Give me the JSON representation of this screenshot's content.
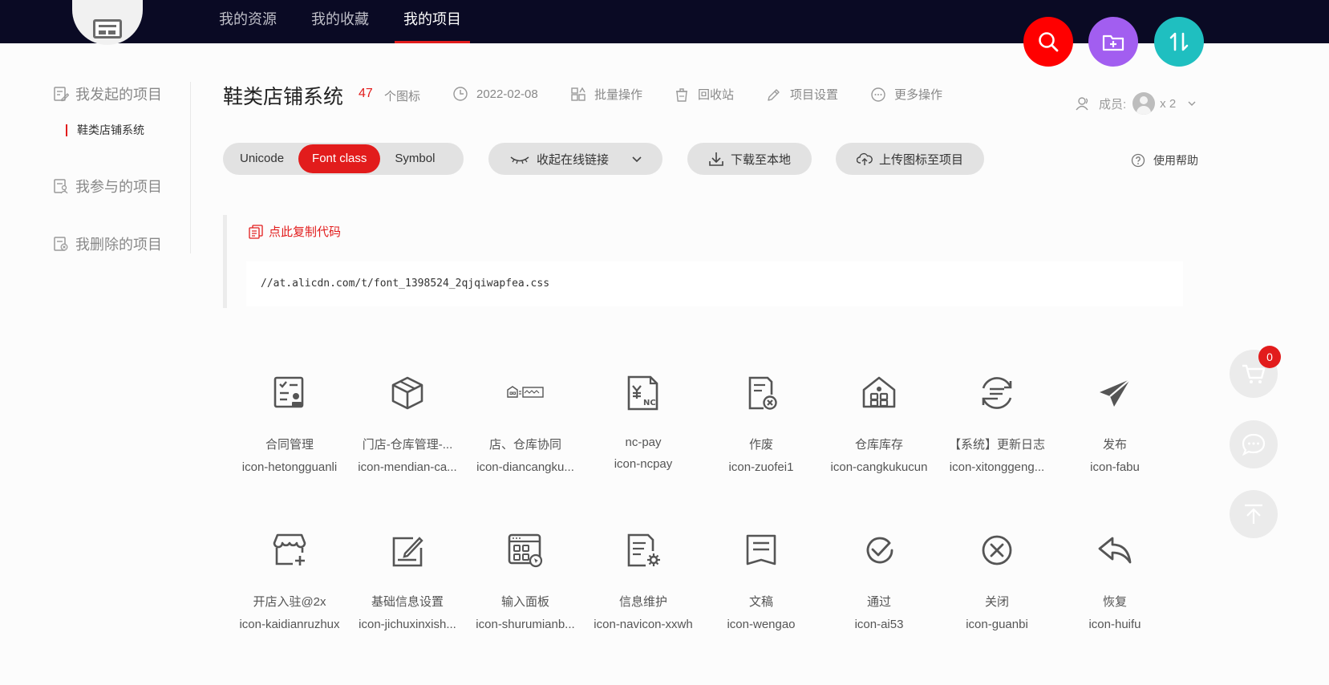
{
  "nav": {
    "tabs": [
      {
        "label": "我的资源"
      },
      {
        "label": "我的收藏"
      },
      {
        "label": "我的项目"
      }
    ]
  },
  "header_actions": {
    "search_icon": "search-icon",
    "add_folder_icon": "folder-add-icon",
    "sort_icon": "sort-arrows-icon",
    "colors": {
      "search": "#ff0000",
      "add_folder": "#a25ef0",
      "sort": "#1fbfc0"
    }
  },
  "sidebar": {
    "initiated": "我发起的项目",
    "current_project": "鞋类店铺系统",
    "participated": "我参与的项目",
    "deleted": "我删除的项目"
  },
  "project": {
    "title": "鞋类店铺系统",
    "icon_count": "47",
    "icon_count_label": "个图标",
    "date": "2022-02-08",
    "batch": "批量操作",
    "trash": "回收站",
    "settings": "项目设置",
    "more": "更多操作",
    "members_label": "成员:",
    "members_count": "x 2"
  },
  "toolbar": {
    "formats": [
      "Unicode",
      "Font class",
      "Symbol"
    ],
    "active_format": "Font class",
    "collapse_link": "收起在线链接",
    "download": "下载至本地",
    "upload": "上传图标至项目",
    "help": "使用帮助"
  },
  "code": {
    "copy_label": "点此复制代码",
    "url": "//at.alicdn.com/t/font_1398524_2qjqiwapfea.css"
  },
  "icons": [
    {
      "name": "合同管理",
      "code": "icon-hetongguanli",
      "glyph": "contract-icon"
    },
    {
      "name": "门店-仓库管理-...",
      "code": "icon-mendian-ca...",
      "glyph": "box-icon"
    },
    {
      "name": "店、仓库协同",
      "code": "icon-diancangku...",
      "glyph": "store-warehouse-icon"
    },
    {
      "name": "nc-pay",
      "code": "icon-ncpay",
      "glyph": "nc-pay-icon"
    },
    {
      "name": "作废",
      "code": "icon-zuofei1",
      "glyph": "void-document-icon"
    },
    {
      "name": "仓库库存",
      "code": "icon-cangkukucun",
      "glyph": "warehouse-icon"
    },
    {
      "name": "【系统】更新日志",
      "code": "icon-xitonggeng...",
      "glyph": "update-log-icon"
    },
    {
      "name": "发布",
      "code": "icon-fabu",
      "glyph": "paper-plane-icon"
    },
    {
      "name": "开店入驻@2x",
      "code": "icon-kaidianruzhux",
      "glyph": "open-store-icon"
    },
    {
      "name": "基础信息设置",
      "code": "icon-jichuxinxish...",
      "glyph": "edit-info-icon"
    },
    {
      "name": "输入面板",
      "code": "icon-shurumianb...",
      "glyph": "input-panel-icon"
    },
    {
      "name": "信息维护",
      "code": "icon-navicon-xxwh",
      "glyph": "doc-settings-icon"
    },
    {
      "name": "文稿",
      "code": "icon-wengao",
      "glyph": "manuscript-icon"
    },
    {
      "name": "通过",
      "code": "icon-ai53",
      "glyph": "check-circle-icon"
    },
    {
      "name": "关闭",
      "code": "icon-guanbi",
      "glyph": "close-circle-icon"
    },
    {
      "name": "恢复",
      "code": "icon-huifu",
      "glyph": "reply-arrow-icon"
    }
  ],
  "float": {
    "cart_count": "0"
  }
}
